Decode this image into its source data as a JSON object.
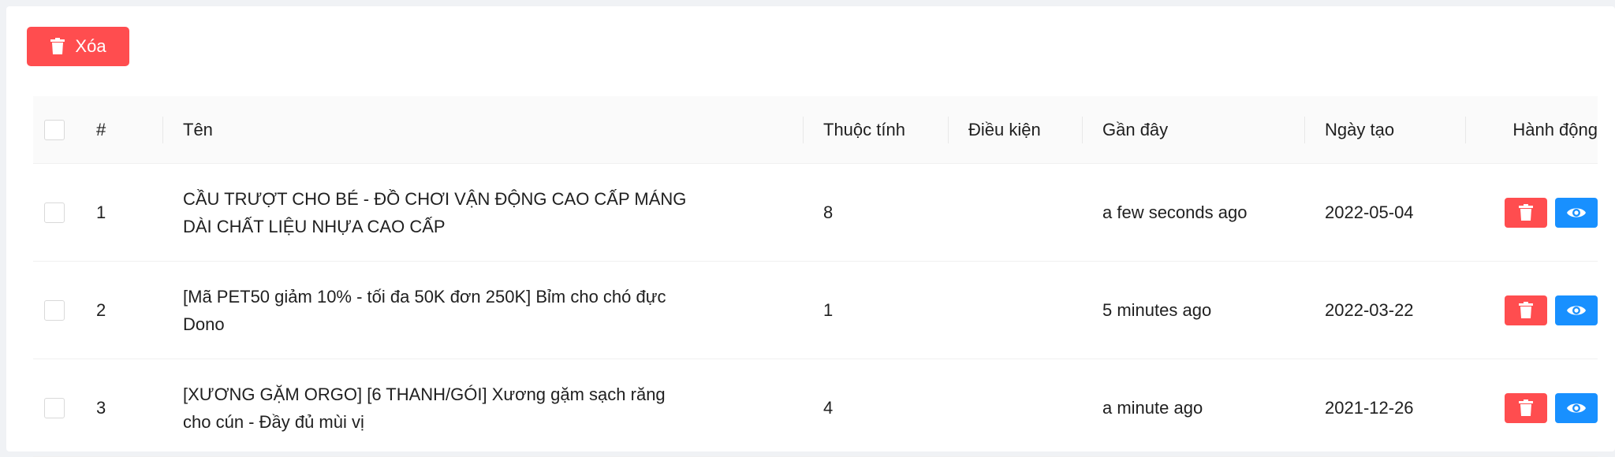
{
  "toolbar": {
    "delete_label": "Xóa",
    "delete_icon": "trash-icon",
    "delete_color": "#ff4d4f"
  },
  "table": {
    "headers": {
      "num": "#",
      "name": "Tên",
      "attributes": "Thuộc tính",
      "conditions": "Điều kiện",
      "recent": "Gần đây",
      "created": "Ngày tạo",
      "actions": "Hành động"
    },
    "rows": [
      {
        "num": "1",
        "name": "CẦU TRƯỢT CHO BÉ - ĐỒ CHƠI VẬN ĐỘNG CAO CẤP MÁNG DÀI CHẤT LIỆU NHỰA CAO CẤP",
        "attributes": "8",
        "conditions": "",
        "recent": "a few seconds ago",
        "created": "2022-05-04"
      },
      {
        "num": "2",
        "name": "[Mã PET50 giảm 10% - tối đa 50K đơn 250K] Bỉm cho chó đực Dono",
        "attributes": "1",
        "conditions": "",
        "recent": "5 minutes ago",
        "created": "2022-03-22"
      },
      {
        "num": "3",
        "name": "[XƯƠNG GẶM ORGO] [6 THANH/GÓI] Xương gặm sạch răng cho cún - Đầy đủ mùi vị",
        "attributes": "4",
        "conditions": "",
        "recent": "a minute ago",
        "created": "2021-12-26"
      }
    ],
    "row_actions": {
      "delete_icon": "trash-icon",
      "view_icon": "eye-icon",
      "delete_color": "#ff4d4f",
      "view_color": "#1890ff"
    }
  }
}
